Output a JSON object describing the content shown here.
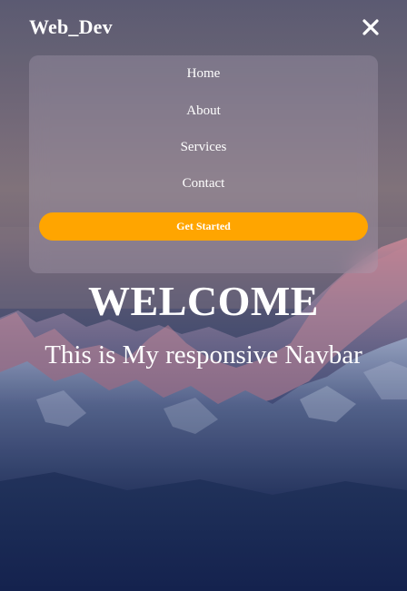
{
  "navbar": {
    "logo": "Web_Dev",
    "close_icon": "close-icon",
    "menu_items": [
      {
        "label": "Home"
      },
      {
        "label": "About"
      },
      {
        "label": "Services"
      },
      {
        "label": "Contact"
      }
    ],
    "cta_label": "Get Started"
  },
  "hero": {
    "title": "WELCOME",
    "subtitle": "This is My responsive Navbar"
  },
  "colors": {
    "accent": "#ffa500",
    "text": "#ffffff",
    "background_bottom": "#16254f"
  }
}
